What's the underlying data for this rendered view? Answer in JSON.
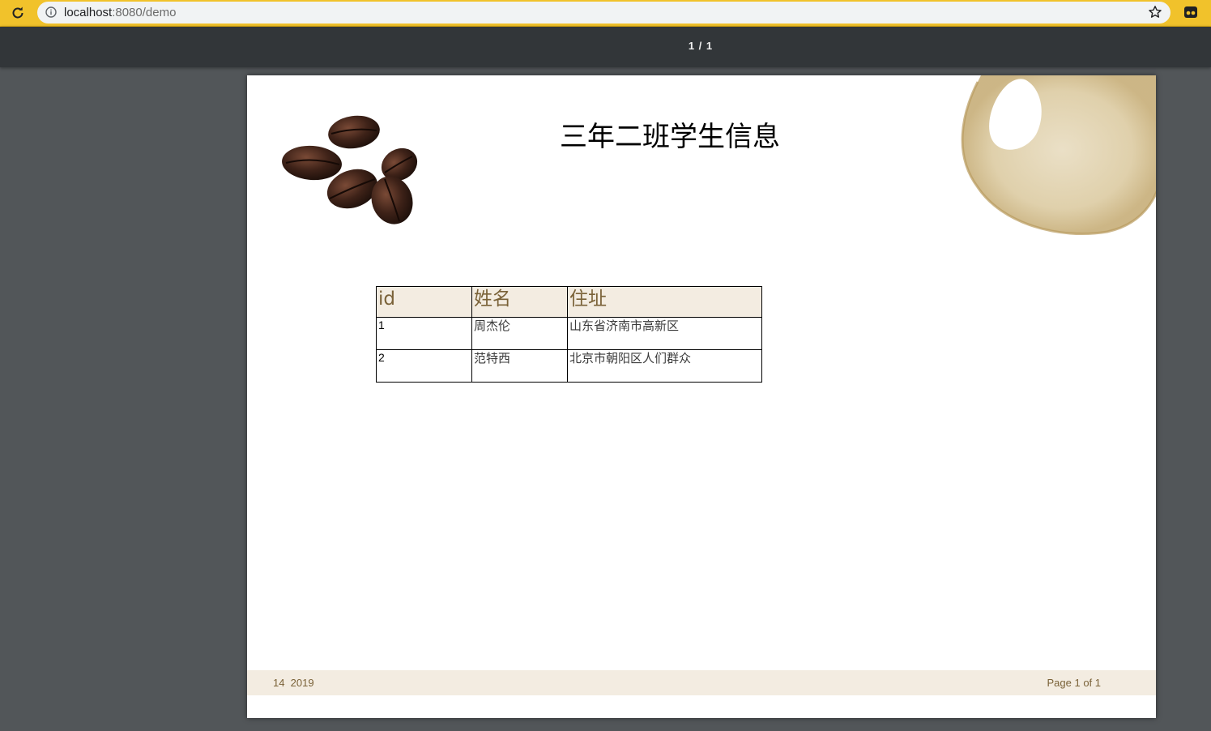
{
  "browser": {
    "url_host": "localhost",
    "url_rest": ":8080/demo"
  },
  "pdf_toolbar": {
    "page_indicator": "1 / 1"
  },
  "document": {
    "title": "三年二班学生信息",
    "table": {
      "headers": [
        "id",
        "姓名",
        "住址"
      ],
      "rows": [
        [
          "1",
          "周杰伦",
          "山东省济南市高新区"
        ],
        [
          "2",
          "范特西",
          "北京市朝阳区人们群众"
        ]
      ]
    },
    "footer": {
      "date": "14  2019",
      "page": "Page 1 of 1"
    }
  },
  "colors": {
    "accent_yellow": "#f1c22b",
    "toolbar_dark": "#323639",
    "viewer_bg": "#525659",
    "table_header_bg": "#f3ece1",
    "table_header_text": "#7a6238"
  },
  "icons": {
    "reload": "reload-icon",
    "info": "info-icon",
    "star": "star-icon",
    "extension": "extension-icon"
  }
}
